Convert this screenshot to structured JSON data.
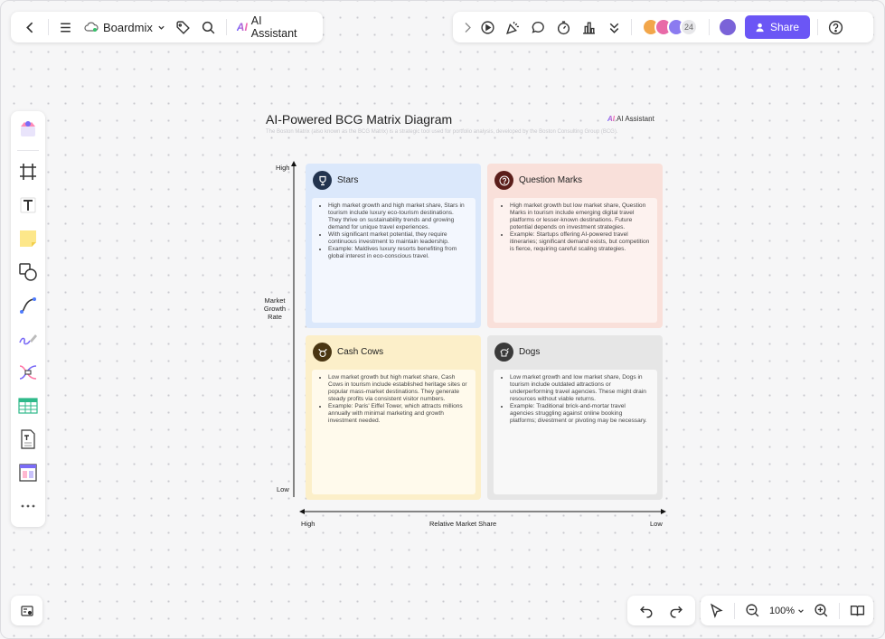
{
  "topbar": {
    "app_name": "Boardmix",
    "ai_assistant_label": "AI Assistant",
    "collaborator_count": "24",
    "share_label": "Share"
  },
  "zoom": {
    "level": "100%"
  },
  "diagram": {
    "title": "AI-Powered BCG Matrix Diagram",
    "badge": "AI Assistant",
    "subtitle": "The Boston Matrix (also known as the BCG Matrix) is a strategic tool used for portfolio analysis, developed by the Boston Consulting Group (BCG).",
    "y_axis": {
      "label": "Market Growth Rate",
      "high": "High",
      "low": "Low"
    },
    "x_axis": {
      "label": "Relative Market Share",
      "high": "High",
      "low": "Low"
    },
    "quadrants": [
      {
        "title": "Stars",
        "points": [
          "High market growth and high market share, Stars in tourism include luxury eco-tourism destinations. They thrive on sustainability trends and growing demand for unique travel experiences.",
          "With significant market potential, they require continuous investment to maintain leadership.",
          "Example: Maldives luxury resorts benefiting from global interest in eco-conscious travel."
        ]
      },
      {
        "title": "Question Marks",
        "points": [
          "High market growth but low market share, Question Marks in tourism include emerging digital travel platforms or lesser-known destinations. Future potential depends on investment strategies.",
          "Example: Startups offering AI-powered travel itineraries; significant demand exists, but competition is fierce, requiring careful scaling strategies."
        ]
      },
      {
        "title": "Cash Cows",
        "points": [
          "Low market growth but high market share, Cash Cows in tourism include established heritage sites or popular mass-market destinations. They generate steady profits via consistent visitor numbers.",
          "Example: Paris' Eiffel Tower, which attracts millions annually with minimal marketing and growth investment needed."
        ]
      },
      {
        "title": "Dogs",
        "points": [
          "Low market growth and low market share, Dogs in tourism include outdated attractions or underperforming travel agencies. These might drain resources without viable returns.",
          "Example: Traditional brick-and-mortar travel agencies struggling against online booking platforms; divestment or pivoting may be necessary."
        ]
      }
    ]
  },
  "colors": {
    "accent": "#6b56f5",
    "stars_bg": "#dbe8fb",
    "question_marks_bg": "#f9e0da",
    "cash_cows_bg": "#fcefc9",
    "dogs_bg": "#e6e6e6"
  }
}
